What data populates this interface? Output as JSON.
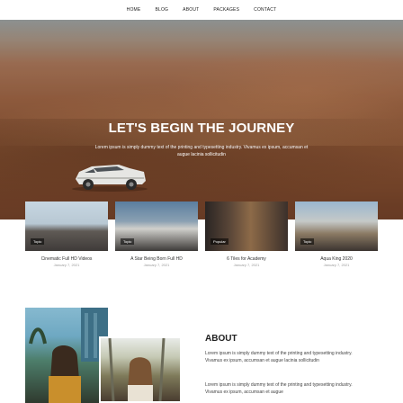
{
  "nav": {
    "items": [
      "HOME",
      "BLOG",
      "ABOUT",
      "PACKAGES",
      "CONTACT"
    ]
  },
  "hero": {
    "title": "LET'S BEGIN THE JOURNEY",
    "subtitle": "Lorem ipsum is simply dummy text of the printing and typesetting industry. Vivamus ex ipsum, accumsan et augue lacinia sollicitudin"
  },
  "cards": [
    {
      "tag": "Topic",
      "title": "Cinematic Full HD Videos",
      "date": "January 7, 2021",
      "image": "city-skyline-photo"
    },
    {
      "tag": "Topic",
      "title": "A Star Being Born Full HD",
      "date": "January 7, 2021",
      "image": "classic-building-photo"
    },
    {
      "tag": "Popular",
      "title": "6 Tiles for Academy",
      "date": "January 7, 2021",
      "image": "street-market-photo"
    },
    {
      "tag": "Topic",
      "title": "Aqua King 2020",
      "date": "January 7, 2021",
      "image": "old-town-photo"
    }
  ],
  "about": {
    "title": "ABOUT",
    "paragraph1": "Lorem ipsum is simply dummy text of the printing and typesetting industry. Vivamus ex ipsum, accumsan et augue lacinia sollicitudin",
    "paragraph2": "Lorem ipsum is simply dummy text of the printing and typesetting industry. Vivamus ex ipsum, accumsan et augue"
  },
  "colors": {
    "nav_bg": "#ffffff",
    "hero_sand": "#9b6444",
    "text_dark": "#222222",
    "date_gray": "#9a9a9a"
  }
}
